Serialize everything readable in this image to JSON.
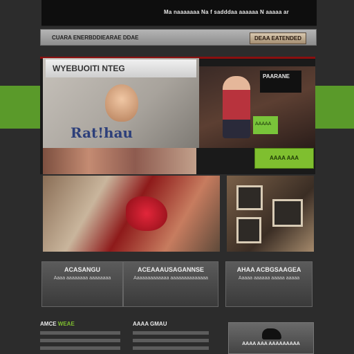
{
  "header": {
    "nav_text": "Ma naaaaaaa Na f sadddaa aaaaaa N aaaaa ar",
    "breadcrumb": "CUARA ENERBDDIEARAE DDAE",
    "action_button": "DEAA EATENDED"
  },
  "hero": {
    "headline": "WYEBUOITI NTEG",
    "logo_text": "Rat!hau",
    "screen_text": "PAARANE",
    "green_box_text": "AAAAA"
  },
  "cta": {
    "label": "AAAA AAA"
  },
  "cards": [
    {
      "title": "ACASANGU",
      "subtitle": "Aaaa aaaaaaaa aaaaaaaa"
    },
    {
      "title": "ACEAAAUSAGANNSE",
      "subtitle": "Aaaaaaaaaaaaa aaaaaaaaaaaaaa"
    },
    {
      "title": "AHAA ACBGSAAGEA",
      "subtitle": "Aaaaa aaaaaa aaaaa aaaaa"
    }
  ],
  "footer": {
    "col1_title_prefix": "AMCE ",
    "col1_title_accent": "WEAE",
    "col2_title": "AAAA GMAU"
  },
  "promo": {
    "label": "AAAA AAA AAAAAAAAA"
  },
  "colors": {
    "background": "#2c2c2c",
    "accent_green": "#7fbf2f",
    "accent_red": "#8b0f0f"
  }
}
